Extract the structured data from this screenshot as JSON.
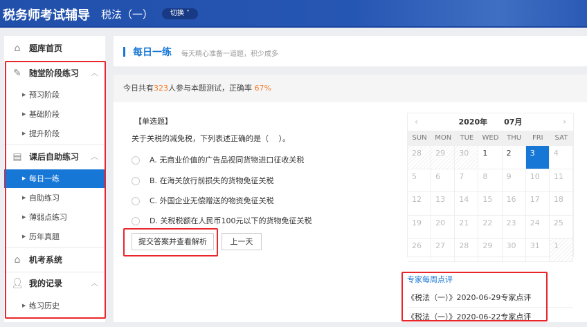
{
  "header": {
    "title": "税务师考试辅导",
    "subject": "税法（一）",
    "switch_label": "切换"
  },
  "sidebar": {
    "home": "题库首页",
    "stage_practice": {
      "label": "随堂阶段练习",
      "items": [
        "预习阶段",
        "基础阶段",
        "提升阶段"
      ]
    },
    "self_practice": {
      "label": "课后自助练习",
      "items": [
        "每日一练",
        "自助练习",
        "薄弱点练习",
        "历年真题"
      ]
    },
    "exam_system": "机考系统",
    "records": {
      "label": "我的记录",
      "items": [
        "练习历史"
      ]
    }
  },
  "topbar": {
    "title": "每日一练",
    "subtitle": "每天精心准备一道题，积少成多"
  },
  "stats": {
    "prefix": "今日共有",
    "count": "323",
    "middle": "人参与本题测试，正确率 ",
    "rate": "67%"
  },
  "question": {
    "type": "【单选题】",
    "text": "关于关税的减免税，下列表述正确的是（　 ）。",
    "options": [
      "A. 无商业价值的广告品视同货物进口征收关税",
      "B. 在海关放行前损失的货物免征关税",
      "C. 外国企业无偿赠送的物资免征关税",
      "D. 关税税额在人民币100元以下的货物免征关税"
    ],
    "submit_label": "提交答案并查看解析",
    "prev_label": "上一天"
  },
  "calendar": {
    "year": "2020年",
    "month": "07月",
    "prev": "‹",
    "next": "›",
    "weekdays": [
      "SUN",
      "MON",
      "TUE",
      "WED",
      "THU",
      "FRI",
      "SAT"
    ],
    "days": [
      "28",
      "29",
      "30",
      "1",
      "2",
      "3",
      "4",
      "5",
      "6",
      "7",
      "8",
      "9",
      "10",
      "11",
      "12",
      "13",
      "14",
      "15",
      "16",
      "17",
      "18",
      "19",
      "20",
      "21",
      "22",
      "23",
      "24",
      "25",
      "26",
      "27",
      "28",
      "29",
      "30",
      "31",
      "1"
    ],
    "selected": "3"
  },
  "expert": {
    "title": "专家每周点评",
    "reviews": [
      "《税法（一）》2020-06-29专家点评",
      "《税法（一）》2020-06-22专家点评"
    ]
  },
  "colors": {
    "brand": "#2150ab",
    "accent": "#1777d6",
    "highlight": "#f07d2d",
    "annotation": "#e8262b"
  }
}
